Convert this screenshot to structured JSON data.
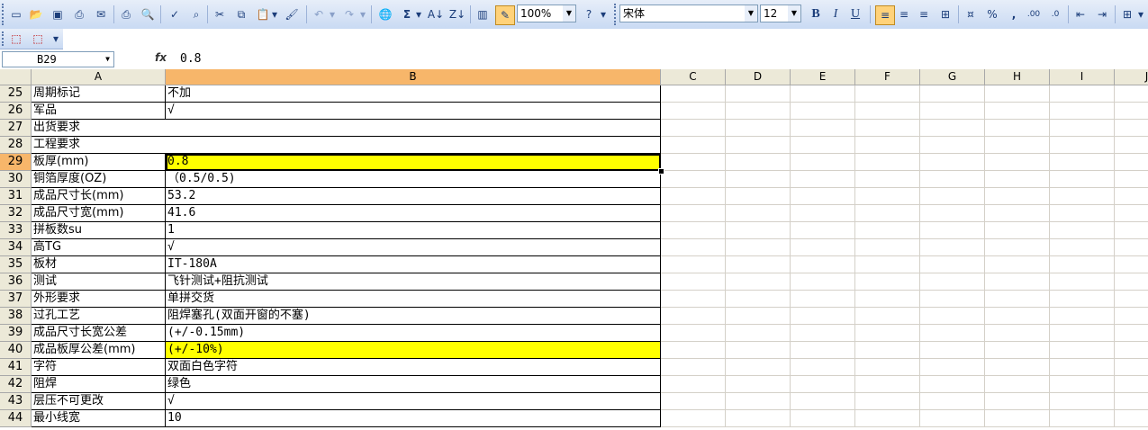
{
  "toolbar": {
    "zoom": "100%",
    "font_name": "宋体",
    "font_size": "12",
    "bold": "B",
    "italic": "I",
    "underline": "U",
    "percent": "%",
    "comma": ","
  },
  "formula_bar": {
    "name_box": "B29",
    "fx": "fx",
    "value": "0.8"
  },
  "columns": [
    "A",
    "B",
    "C",
    "D",
    "E",
    "F",
    "G",
    "H",
    "I",
    "J"
  ],
  "rows": [
    {
      "num": "25",
      "a": "周期标记",
      "b": "不加"
    },
    {
      "num": "26",
      "a": "军品",
      "b": "√"
    },
    {
      "num": "27",
      "a": "出货要求",
      "b": ""
    },
    {
      "num": "28",
      "a": "工程要求",
      "b": ""
    },
    {
      "num": "29",
      "a": "板厚(mm)",
      "b": "0.8"
    },
    {
      "num": "30",
      "a": "铜箔厚度(OZ)",
      "b": "（0.5/0.5)"
    },
    {
      "num": "31",
      "a": "成品尺寸长(mm)",
      "b": "53.2"
    },
    {
      "num": "32",
      "a": "成品尺寸宽(mm)",
      "b": "41.6"
    },
    {
      "num": "33",
      "a": "拼板数su",
      "b": "1"
    },
    {
      "num": "34",
      "a": "高TG",
      "b": "√"
    },
    {
      "num": "35",
      "a": "板材",
      "b": "IT-180A"
    },
    {
      "num": "36",
      "a": "测试",
      "b": "飞针测试+阻抗测试"
    },
    {
      "num": "37",
      "a": "外形要求",
      "b": "单拼交货"
    },
    {
      "num": "38",
      "a": "过孔工艺",
      "b": "阻焊塞孔(双面开窗的不塞)"
    },
    {
      "num": "39",
      "a": "成品尺寸长宽公差",
      "b": "(+/-0.15mm)"
    },
    {
      "num": "40",
      "a": "成品板厚公差(mm)",
      "b": "(+/-10%)"
    },
    {
      "num": "41",
      "a": "字符",
      "b": "双面白色字符"
    },
    {
      "num": "42",
      "a": "阻焊",
      "b": "绿色"
    },
    {
      "num": "43",
      "a": "层压不可更改",
      "b": "√"
    },
    {
      "num": "44",
      "a": "最小线宽",
      "b": "10"
    }
  ],
  "highlight_color": "#ffff00",
  "selection_header_color": "#f7b66a"
}
